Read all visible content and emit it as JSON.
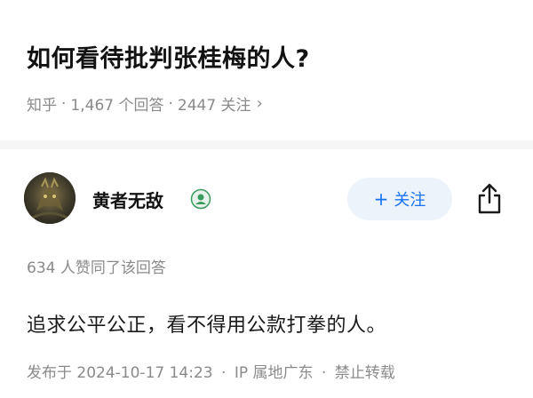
{
  "question": {
    "title": "如何看待批判张桂梅的人?",
    "site": "知乎",
    "answer_count": "1,467 个回答",
    "follower_count": "2447 关注",
    "separator": "·",
    "chevron": "›"
  },
  "author": {
    "name": "黄者无敌",
    "avatar_icon": "avatar-image",
    "badge_icon": "user-badge-icon"
  },
  "follow_button": {
    "plus": "+",
    "label": "关注"
  },
  "share": {
    "icon": "share-icon"
  },
  "answer": {
    "upvotes_text": "634 人赞同了该回答",
    "content": "追求公平公正，看不得用公款打拳的人。",
    "published": "发布于 2024-10-17 14:23",
    "ip_location": "IP 属地广东",
    "repost_notice": "禁止转载",
    "separator": "·"
  },
  "colors": {
    "accent": "#1772f6",
    "follow_bg": "#ecf3fb",
    "meta_text": "#8a8a8a",
    "divider": "#f6f6f6"
  }
}
